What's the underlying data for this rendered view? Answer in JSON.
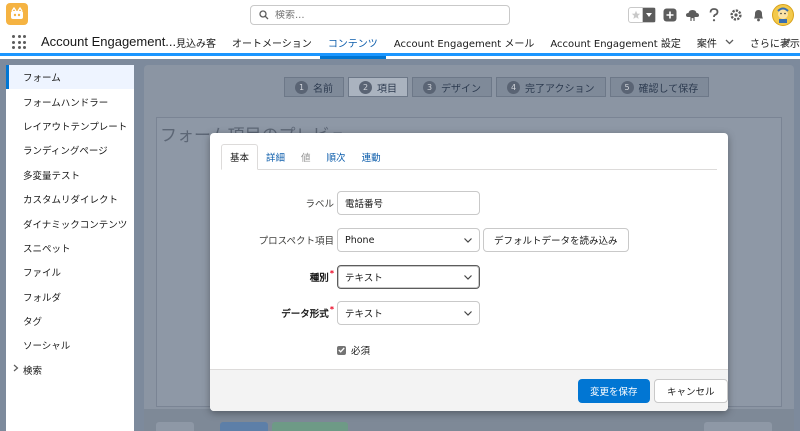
{
  "header": {
    "search": {
      "placeholder": "検索..."
    }
  },
  "nav": {
    "app_name": "Account Engagement...",
    "items": [
      {
        "label": "見込み客"
      },
      {
        "label": "オートメーション"
      },
      {
        "label": "コンテンツ",
        "active": true
      },
      {
        "label": "Account Engagement メール"
      },
      {
        "label": "Account Engagement 設定"
      },
      {
        "label": "案件"
      },
      {
        "label": "さらに表示"
      }
    ]
  },
  "sidebar": {
    "items": [
      {
        "label": "フォーム",
        "active": true
      },
      {
        "label": "フォームハンドラー"
      },
      {
        "label": "レイアウトテンプレート"
      },
      {
        "label": "ランディングページ"
      },
      {
        "label": "多変量テスト"
      },
      {
        "label": "カスタムリダイレクト"
      },
      {
        "label": "ダイナミックコンテンツ"
      },
      {
        "label": "スニペット"
      },
      {
        "label": "ファイル"
      },
      {
        "label": "フォルダ"
      },
      {
        "label": "タグ"
      },
      {
        "label": "ソーシャル"
      },
      {
        "label": "検索"
      }
    ]
  },
  "wizard": {
    "steps": [
      {
        "num": "1",
        "label": "名前"
      },
      {
        "num": "2",
        "label": "項目",
        "current": true
      },
      {
        "num": "3",
        "label": "デザイン"
      },
      {
        "num": "4",
        "label": "完了アクション"
      },
      {
        "num": "5",
        "label": "確認して保存"
      }
    ],
    "preview_title": "フォーム項目のプレビュー"
  },
  "modal": {
    "tabs": [
      {
        "label": "基本",
        "active": true
      },
      {
        "label": "詳細"
      },
      {
        "label": "値",
        "disabled": true
      },
      {
        "label": "順次"
      },
      {
        "label": "連動"
      }
    ],
    "fields": {
      "label": {
        "label": "ラベル",
        "value": "電話番号"
      },
      "prospect_field": {
        "label": "プロスペクト項目",
        "value": "Phone",
        "button": "デフォルトデータを読み込み"
      },
      "type": {
        "label": "種別",
        "value": "テキスト",
        "required_mark": "*"
      },
      "data_format": {
        "label": "データ形式",
        "value": "テキスト",
        "required_mark": "*"
      },
      "required": {
        "label": "必須",
        "checked": true
      }
    },
    "footer": {
      "save": "変更を保存",
      "cancel": "キャンセル"
    }
  },
  "colors": {
    "brand": "#0176d3",
    "nav_accent": "#1b96ff",
    "overlay": "#7d8a9c"
  }
}
